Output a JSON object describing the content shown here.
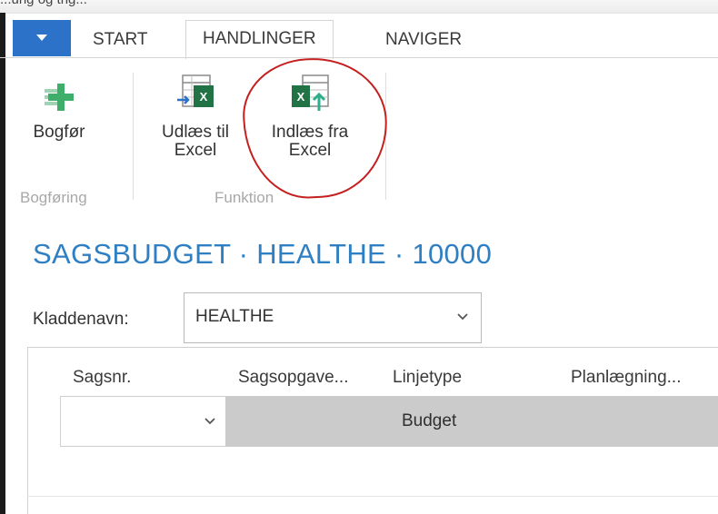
{
  "top_fragment": "...ung og trig...",
  "tabs": [
    "START",
    "HANDLINGER",
    "NAVIGER"
  ],
  "ribbon": {
    "post_label": "Bogfør",
    "group1_label": "Bogføring",
    "export_label_1": "Udlæs til",
    "export_label_2": "Excel",
    "import_label_1": "Indlæs fra",
    "import_label_2": "Excel",
    "group2_label": "Funktion"
  },
  "page_title": "SAGSBUDGET · HEALTHE · 10000",
  "journal": {
    "label": "Kladdenavn:",
    "value": "HEALTHE"
  },
  "table": {
    "columns": [
      "Sagsnr.",
      "Sagsopgave...",
      "Linjetype",
      "Planlægning..."
    ],
    "rows": [
      {
        "sagsnr": "",
        "linjetype": "Budget"
      }
    ]
  },
  "colors": {
    "accent_blue": "#2b72c8",
    "title_blue": "#2f7fc4",
    "excel_green": "#217346",
    "annotation_red": "#c42020"
  },
  "icons": [
    "post-plus-icon",
    "export-excel-icon",
    "import-excel-icon",
    "chevron-down-icon"
  ]
}
